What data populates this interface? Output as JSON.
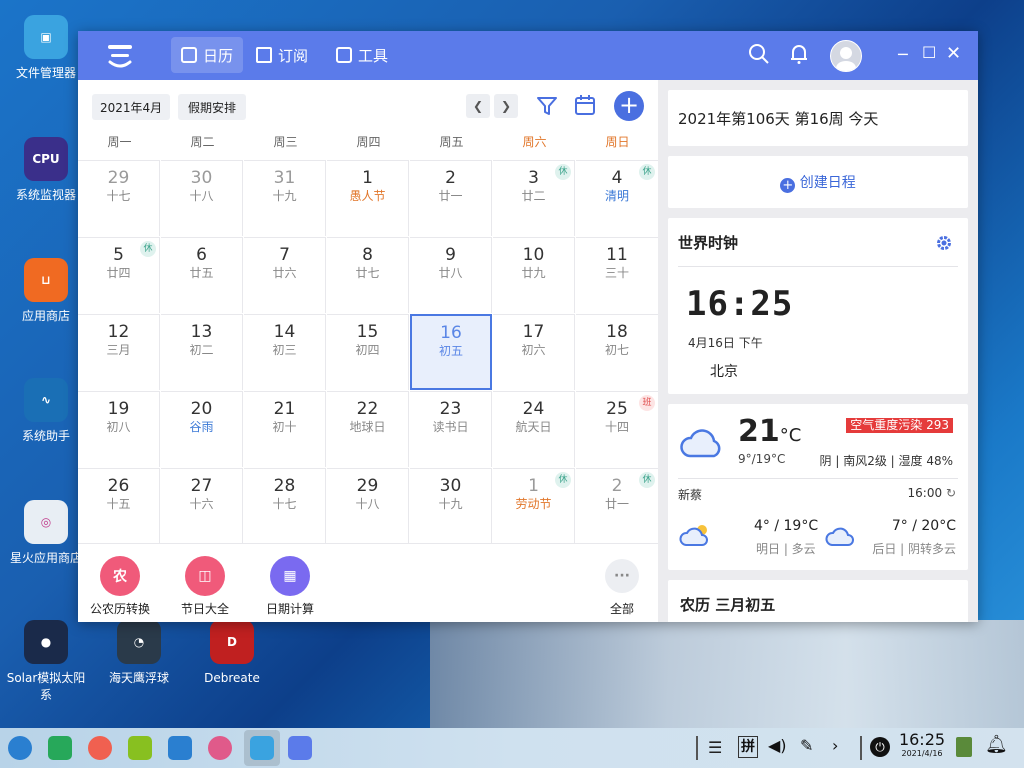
{
  "desktop": {
    "icons": [
      {
        "label": "文件管理器",
        "color": "#3aa3e0",
        "glyph": "▣"
      },
      {
        "label": "系统监视器",
        "color": "#3a2f8a",
        "glyph": "CPU"
      },
      {
        "label": "应用商店",
        "color": "#f06a22",
        "glyph": "⊔"
      },
      {
        "label": "系统助手",
        "color": "#1a6fb5",
        "glyph": "∿"
      },
      {
        "label": "星火应用商店",
        "color": "#e8eef4",
        "glyph": "◎"
      },
      {
        "label": "Solar模拟太阳系",
        "color": "#1a2a4a",
        "glyph": "●"
      },
      {
        "label": "海天鹰浮球",
        "color": "#2a3a4a",
        "glyph": "◔"
      },
      {
        "label": "Debreate",
        "color": "#c02020",
        "glyph": "D"
      }
    ]
  },
  "window": {
    "tabs": [
      {
        "label": "日历"
      },
      {
        "label": "订阅"
      },
      {
        "label": "工具"
      }
    ],
    "month_label": "2021年4月",
    "holiday_button": "假期安排",
    "weekdays": [
      "周一",
      "周二",
      "周三",
      "周四",
      "周五",
      "周六",
      "周日"
    ],
    "days": [
      {
        "d": "29",
        "l": "十七",
        "o": true
      },
      {
        "d": "30",
        "l": "十八",
        "o": true
      },
      {
        "d": "31",
        "l": "十九",
        "o": true
      },
      {
        "d": "1",
        "l": "愚人节",
        "t": "fest"
      },
      {
        "d": "2",
        "l": "廿一"
      },
      {
        "d": "3",
        "l": "廿二",
        "b": "休"
      },
      {
        "d": "4",
        "l": "清明",
        "t": "term",
        "b": "休"
      },
      {
        "d": "5",
        "l": "廿四",
        "b": "休"
      },
      {
        "d": "6",
        "l": "廿五"
      },
      {
        "d": "7",
        "l": "廿六"
      },
      {
        "d": "8",
        "l": "廿七"
      },
      {
        "d": "9",
        "l": "廿八"
      },
      {
        "d": "10",
        "l": "廿九"
      },
      {
        "d": "11",
        "l": "三十"
      },
      {
        "d": "12",
        "l": "三月"
      },
      {
        "d": "13",
        "l": "初二"
      },
      {
        "d": "14",
        "l": "初三"
      },
      {
        "d": "15",
        "l": "初四"
      },
      {
        "d": "16",
        "l": "初五",
        "s": true
      },
      {
        "d": "17",
        "l": "初六"
      },
      {
        "d": "18",
        "l": "初七"
      },
      {
        "d": "19",
        "l": "初八"
      },
      {
        "d": "20",
        "l": "谷雨",
        "t": "term"
      },
      {
        "d": "21",
        "l": "初十"
      },
      {
        "d": "22",
        "l": "地球日"
      },
      {
        "d": "23",
        "l": "读书日"
      },
      {
        "d": "24",
        "l": "航天日"
      },
      {
        "d": "25",
        "l": "十四",
        "b": "班"
      },
      {
        "d": "26",
        "l": "十五"
      },
      {
        "d": "27",
        "l": "十六"
      },
      {
        "d": "28",
        "l": "十七"
      },
      {
        "d": "29",
        "l": "十八"
      },
      {
        "d": "30",
        "l": "十九"
      },
      {
        "d": "1",
        "l": "劳动节",
        "o": true,
        "t": "fest",
        "b": "休"
      },
      {
        "d": "2",
        "l": "廿一",
        "o": true,
        "b": "休"
      }
    ],
    "tools": [
      {
        "label": "公农历转换",
        "color": "#f05a7a",
        "glyph": "农"
      },
      {
        "label": "节日大全",
        "color": "#f05a7a",
        "glyph": "◫"
      },
      {
        "label": "日期计算",
        "color": "#7a6af0",
        "glyph": "▦"
      },
      {
        "label": "全部",
        "color": "#eceef2",
        "glyph": "···"
      }
    ],
    "side": {
      "day_info": "2021年第106天 第16周 今天",
      "create": "创建日程",
      "clock_title": "世界时钟",
      "clock_time": "16:25",
      "clock_date": "4月16日 下午",
      "clock_city": "北京",
      "weather": {
        "temp": "21",
        "unit": "°C",
        "range": "9°/19°C",
        "aqi": "空气重度污染 293",
        "desc": "阴 | 南风2级 | 湿度 48%",
        "location": "新蔡",
        "updated": "16:00",
        "tomorrow_temp": "4° / 19°C",
        "tomorrow_desc": "明日 | 多云",
        "after_temp": "7° / 20°C",
        "after_desc": "后日 | 阴转多云"
      },
      "lunar": "农历 三月初五"
    }
  },
  "taskbar": {
    "time": "16:25",
    "date": "2021/4/16",
    "ime": "拼"
  }
}
